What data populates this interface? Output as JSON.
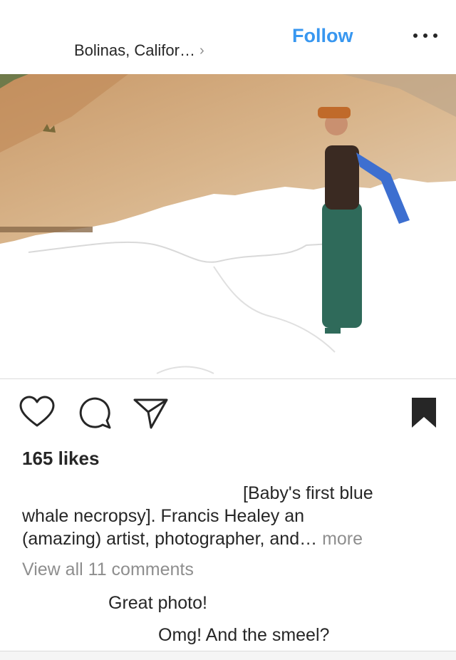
{
  "header": {
    "location": "Bolinas, Califor…",
    "follow_label": "Follow"
  },
  "post": {
    "likes": "165 likes",
    "caption_line1": "[Baby's first blue",
    "caption_line2": "whale necropsy]. Francis Healey an",
    "caption_line3": "(amazing) artist, photographer, and…",
    "caption_more": "more",
    "view_all_comments": "View all 11 comments",
    "comments": [
      {
        "text": "Great photo!"
      },
      {
        "text": "Omg! And the smeel?"
      }
    ]
  },
  "colors": {
    "accent": "#3897f0",
    "text": "#262626",
    "secondary": "#8e8e8e"
  },
  "icons": {
    "like": "heart-icon",
    "comment": "comment-icon",
    "share": "send-icon",
    "save": "bookmark-icon",
    "more": "more-dots-icon",
    "location": "chevron-right-icon"
  }
}
